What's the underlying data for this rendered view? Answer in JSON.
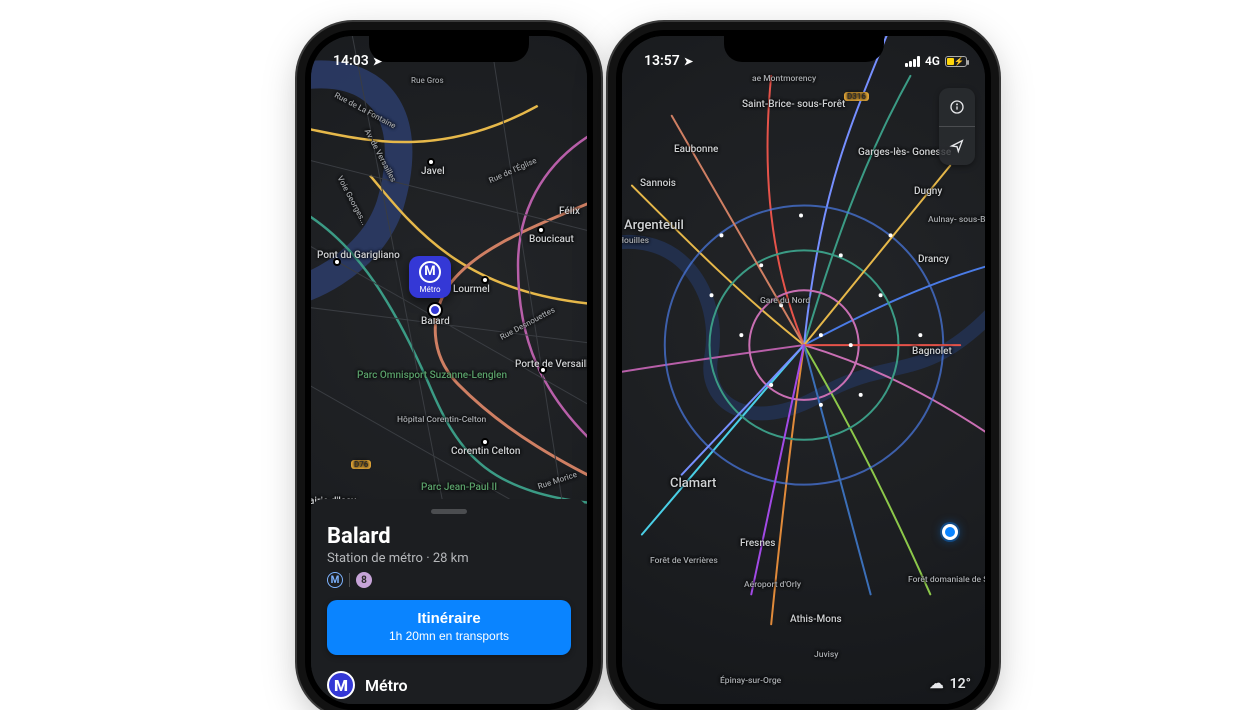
{
  "left": {
    "status": {
      "time": "14:03"
    },
    "pin_label": "Métro",
    "station_label": "Balard",
    "labels": {
      "javel": "Javel",
      "pont_garigliano": "Pont du\nGarigliano",
      "lourmel": "Lourmel",
      "balard": "Balard",
      "boucicaut": "Boucicaut",
      "felix": "Félix",
      "porte_versailles": "Porte de\nVersailles",
      "corentin_celton": "Corentin Celton",
      "parc_jean_paul_ii": "Parc Jean-Paul II",
      "parc_omnisport": "Parc Omnisport\nSuzanne-Lenglen",
      "hopital_corentin": "Hôpital\nCorentin-Celton",
      "rue_gros": "Rue Gros",
      "av_versailles": "Av. de Versailles",
      "voie_georges": "Voie Georges...",
      "rue_la_fontaine": "Rue de La Fontaine",
      "rue_eglise": "Rue de l'Église",
      "rue_desnouettes": "Rue Desnouettes",
      "mairie_issy": "airie d'Issy",
      "rue_morice": "Rue Morice",
      "d76": "D76"
    },
    "sheet": {
      "title": "Balard",
      "subtitle_type": "Station de métro",
      "subtitle_distance": "28 km",
      "line_number": "8",
      "route_button": "Itinéraire",
      "route_sub": "1h 20mn en transports",
      "metro_label": "Métro"
    }
  },
  "right": {
    "status": {
      "time": "13:57",
      "network": "4G"
    },
    "labels": {
      "saint_brice": "Saint-Brice-\nsous-Forêt",
      "eaubonne": "Eaubonne",
      "sannois": "Sannois",
      "garges": "Garges-lès-\nGonesse",
      "dugny": "Dugny",
      "argenteuil": "Argenteuil",
      "houilles": "Houilles",
      "aulnay": "Aulnay-\nsous-Bois",
      "drancy": "Drancy",
      "gare_nord": "Gare du Nord",
      "bagnolet": "Bagnolet",
      "clamart": "Clamart",
      "fresnes": "Fresnes",
      "athis_mons": "Athis-Mons",
      "juvisy": "Juvisy",
      "epinay": "Épinay-sur-Orge",
      "orly": "Aéroport d'Orly",
      "foret_verrieres": "Forêt de Verrières",
      "foret_senart": "Forêt domaniale\nde Sénart",
      "d316": "D316",
      "montmorency": "ae Montmorency"
    },
    "weather": {
      "temp": "12°"
    }
  }
}
